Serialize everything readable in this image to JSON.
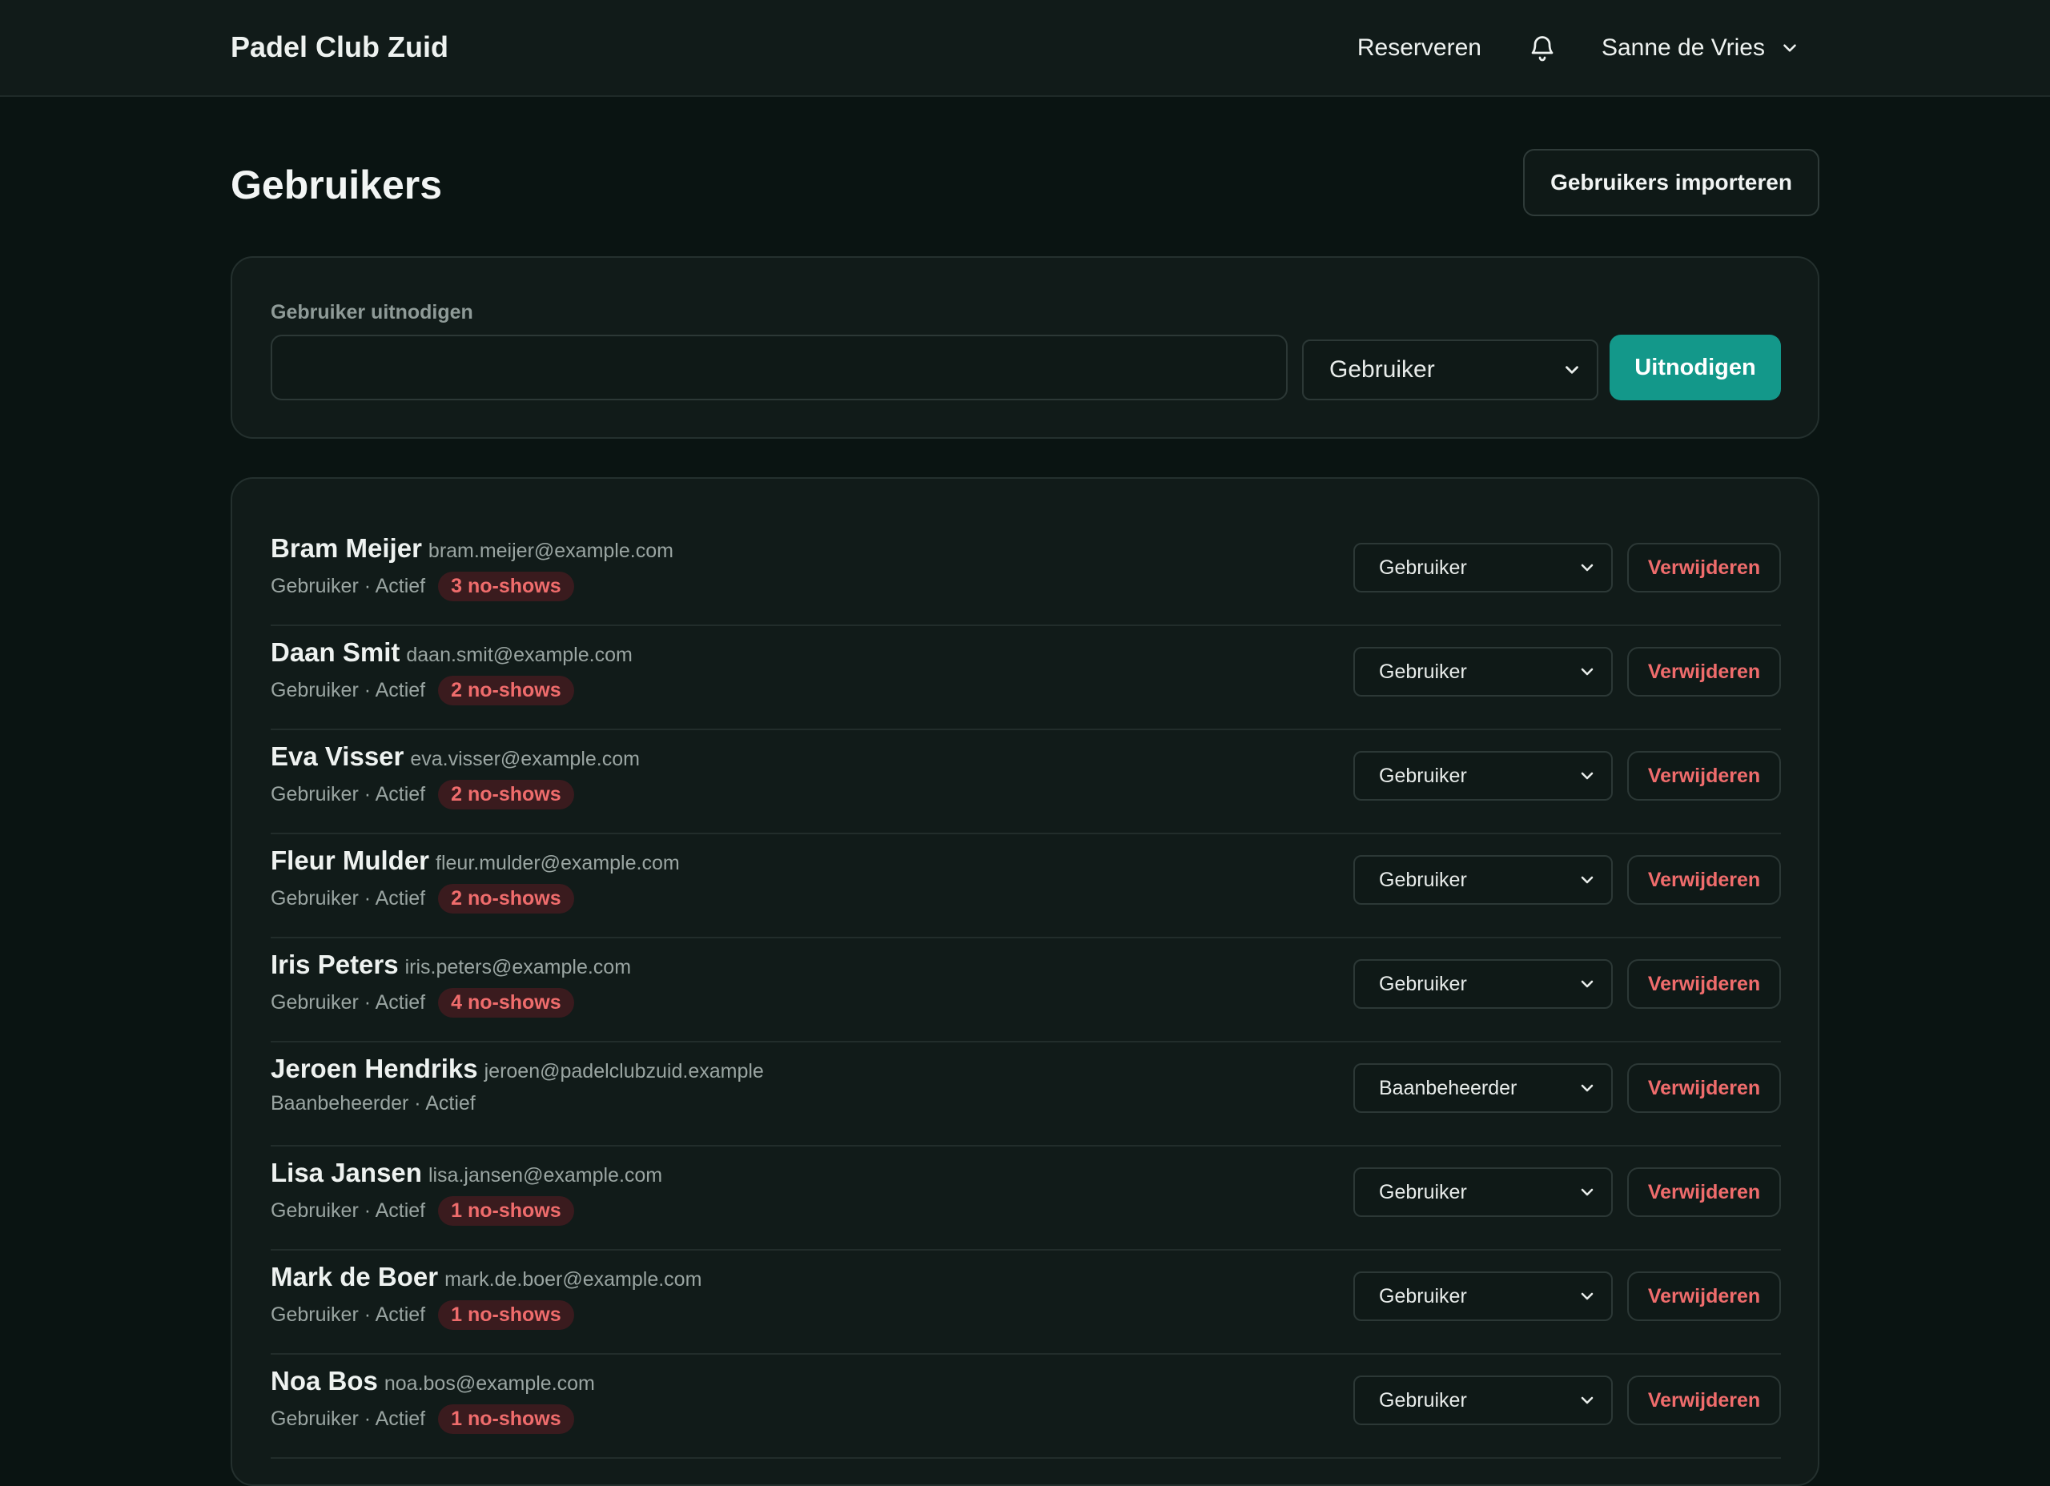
{
  "header": {
    "brand": "Padel Club Zuid",
    "nav_reserve": "Reserveren",
    "user_name": "Sanne de Vries"
  },
  "page": {
    "title": "Gebruikers",
    "import_button": "Gebruikers importeren"
  },
  "invite": {
    "label": "Gebruiker uitnodigen",
    "email_value": "",
    "role_selected": "Gebruiker",
    "submit_label": "Uitnodigen"
  },
  "users": [
    {
      "name": "Bram Meijer",
      "email": "bram.meijer@example.com",
      "meta": "Gebruiker · Actief",
      "noshows": "3 no-shows",
      "role": "Gebruiker",
      "delete": "Verwijderen"
    },
    {
      "name": "Daan Smit",
      "email": "daan.smit@example.com",
      "meta": "Gebruiker · Actief",
      "noshows": "2 no-shows",
      "role": "Gebruiker",
      "delete": "Verwijderen"
    },
    {
      "name": "Eva Visser",
      "email": "eva.visser@example.com",
      "meta": "Gebruiker · Actief",
      "noshows": "2 no-shows",
      "role": "Gebruiker",
      "delete": "Verwijderen"
    },
    {
      "name": "Fleur Mulder",
      "email": "fleur.mulder@example.com",
      "meta": "Gebruiker · Actief",
      "noshows": "2 no-shows",
      "role": "Gebruiker",
      "delete": "Verwijderen"
    },
    {
      "name": "Iris Peters",
      "email": "iris.peters@example.com",
      "meta": "Gebruiker · Actief",
      "noshows": "4 no-shows",
      "role": "Gebruiker",
      "delete": "Verwijderen"
    },
    {
      "name": "Jeroen Hendriks",
      "email": "jeroen@padelclubzuid.example",
      "meta": "Baanbeheerder · Actief",
      "noshows": "",
      "role": "Baanbeheerder",
      "delete": "Verwijderen"
    },
    {
      "name": "Lisa Jansen",
      "email": "lisa.jansen@example.com",
      "meta": "Gebruiker · Actief",
      "noshows": "1 no-shows",
      "role": "Gebruiker",
      "delete": "Verwijderen"
    },
    {
      "name": "Mark de Boer",
      "email": "mark.de.boer@example.com",
      "meta": "Gebruiker · Actief",
      "noshows": "1 no-shows",
      "role": "Gebruiker",
      "delete": "Verwijderen"
    },
    {
      "name": "Noa Bos",
      "email": "noa.bos@example.com",
      "meta": "Gebruiker · Actief",
      "noshows": "1 no-shows",
      "role": "Gebruiker",
      "delete": "Verwijderen"
    }
  ],
  "icons": {
    "notifications": "bell-icon",
    "user_menu": "chevron-down-icon",
    "select": "chevron-down-icon"
  },
  "colors": {
    "accent": "#13988a",
    "danger": "#ef6c6c",
    "background": "#0a1412",
    "surface": "#111b19"
  }
}
